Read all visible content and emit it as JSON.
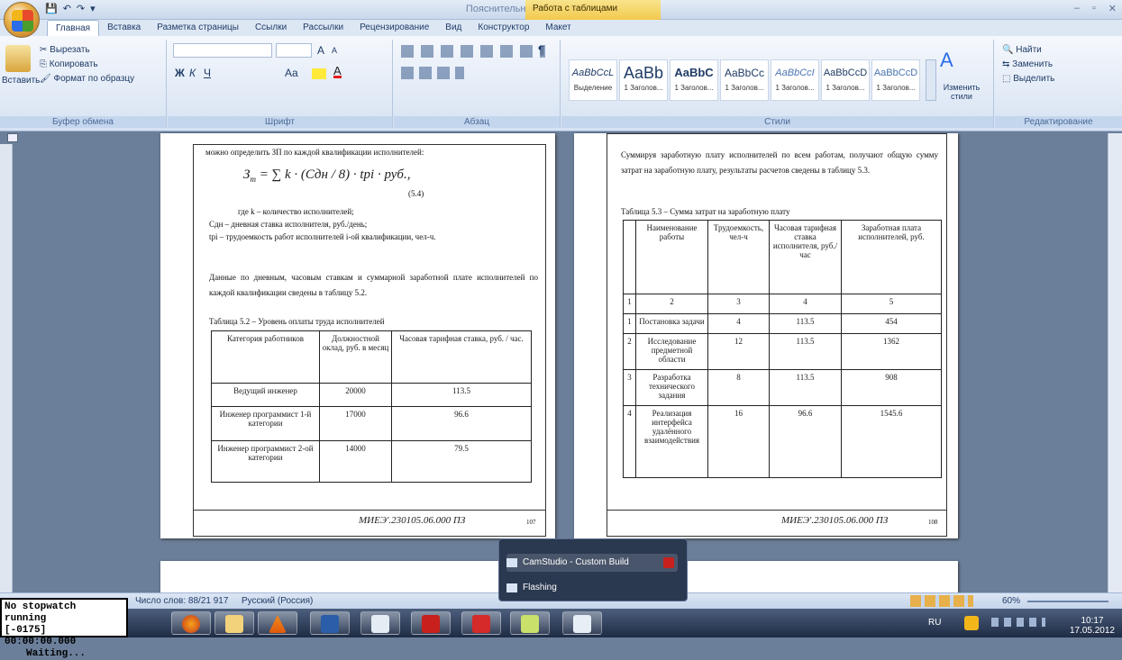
{
  "window": {
    "title": "Пояснительная записка5 - Microsoft Word",
    "context_tab_group": "Работа с таблицами",
    "controls": [
      "–",
      "▫",
      "✕"
    ]
  },
  "quick_access": [
    "💾",
    "↶",
    "↷",
    "▾"
  ],
  "ribbon_tabs": [
    "Главная",
    "Вставка",
    "Разметка страницы",
    "Ссылки",
    "Рассылки",
    "Рецензирование",
    "Вид",
    "Конструктор",
    "Макет"
  ],
  "clipboard": {
    "paste": "Вставить",
    "cut": "Вырезать",
    "copy": "Копировать",
    "format_painter": "Формат по образцу",
    "label": "Буфер обмена"
  },
  "font_group": {
    "label": "Шрифт",
    "bold": "Ж",
    "italic": "К",
    "underline": "Ч",
    "grow": "A",
    "shrink": "A",
    "change_case": "Aa"
  },
  "paragraph_group": {
    "label": "Абзац",
    "pilcrow": "¶"
  },
  "styles_group": {
    "label": "Стили",
    "items": [
      {
        "sample": "AaBbCcL",
        "name": "Выделение"
      },
      {
        "sample": "AaBb",
        "name": "1 Заголов..."
      },
      {
        "sample": "AaBbC",
        "name": "1 Заголов..."
      },
      {
        "sample": "AaBbCc",
        "name": "1 Заголов..."
      },
      {
        "sample": "AaBbCcI",
        "name": "1 Заголов..."
      },
      {
        "sample": "AaBbCcD",
        "name": "1 Заголов..."
      },
      {
        "sample": "AaBbCcD",
        "name": "1 Заголов..."
      }
    ],
    "change_styles": "Изменить стили"
  },
  "editing_group": {
    "label": "Редактирование",
    "find": "Найти",
    "replace": "Заменить",
    "select": "Выделить"
  },
  "left_page": {
    "intro": "можно определить ЗП по каждой квалификации исполнителей:",
    "formula": "З",
    "formula_body": "= ∑ k · (Сдн / 8) · tрi · руб.,",
    "formula_number": "(5.4)",
    "where1": "где k – количество исполнителей;",
    "where2": "Сдн – дневная ставка исполнителя, руб./день;",
    "where3": "tрi – трудоемкость работ исполнителей i-ой квалификации, чел-ч.",
    "para": "Данные по дневным, часовым ставкам и суммарной заработной плате исполнителей по каждой квалификации сведены в таблицу 5.2.",
    "table_caption": "Таблица 5.2 – Уровень оплаты труда исполнителей",
    "table_header": [
      "Категория работников",
      "Должностной оклад, руб. в месяц",
      "Часовая тарифная ставка, руб. / час."
    ],
    "table_rows": [
      [
        "Ведущий инженер",
        "20000",
        "113.5"
      ],
      [
        "Инженер программист 1-й категории",
        "17000",
        "96.6"
      ],
      [
        "Инженер программист 2-ой категории",
        "14000",
        "79.5"
      ]
    ],
    "stamp_code": "МИЕЭ'.230105.06.000 ПЗ",
    "page_no": "107"
  },
  "right_page": {
    "para": "Суммируя заработную плату исполнителей по всем работам, получают общую сумму затрат на заработную плату, результаты расчетов сведены в таблицу 5.3.",
    "table_caption": "Таблица 5.3 – Сумма затрат на заработную плату",
    "table_header": [
      "",
      "Наименование работы",
      "Трудоемкость, чел-ч",
      "Часовая тарифная ставка исполнителя, руб./час",
      "Заработная плата исполнителей, руб."
    ],
    "table_rows": [
      [
        "1",
        "2",
        "3",
        "4",
        "5"
      ],
      [
        "1",
        "Постановка задачи",
        "4",
        "113.5",
        "454"
      ],
      [
        "2",
        "Исследование предметной области",
        "12",
        "113.5",
        "1362"
      ],
      [
        "3",
        "Разработка технического задания",
        "8",
        "113.5",
        "908"
      ],
      [
        "4",
        "Реализация интерфейса удалённого взаимодействия",
        "16",
        "96.6",
        "1545.6"
      ]
    ],
    "stamp_code": "МИЕЭ'.230105.06.000 ПЗ",
    "page_no": "108"
  },
  "status_bar": {
    "word_count": "Число слов: 88/21 917",
    "language": "Русский (Россия)",
    "zoom": "60%"
  },
  "taskbar_popup": {
    "item1": "CamStudio - Custom Build",
    "item2": "Flashing"
  },
  "overlay": {
    "line1": "No stopwatch running",
    "line2": "[-0175] 00:00:00.000",
    "line3": "Waiting..."
  },
  "tray": {
    "lang": "RU",
    "time": "10:17",
    "date": "17.05.2012"
  }
}
